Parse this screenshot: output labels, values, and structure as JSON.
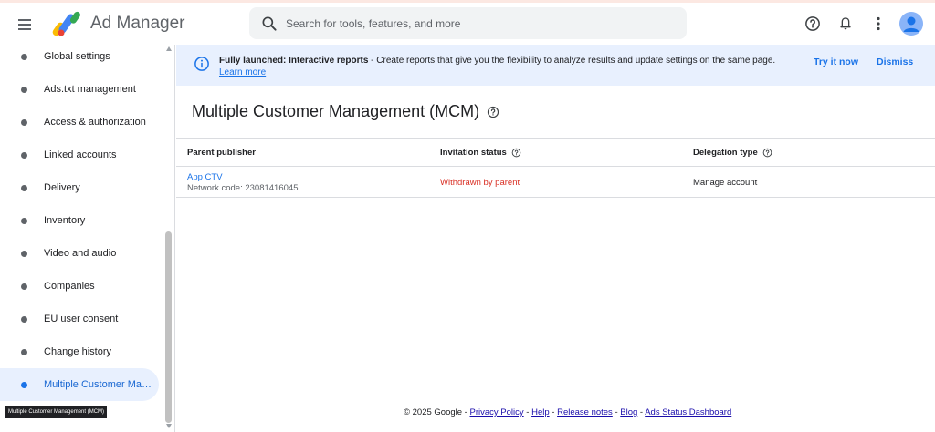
{
  "header": {
    "app_title": "Ad Manager",
    "search_placeholder": "Search for tools, features, and more"
  },
  "sidebar": {
    "items": [
      {
        "label": "Global settings"
      },
      {
        "label": "Ads.txt management"
      },
      {
        "label": "Access & authorization"
      },
      {
        "label": "Linked accounts"
      },
      {
        "label": "Delivery"
      },
      {
        "label": "Inventory"
      },
      {
        "label": "Video and audio"
      },
      {
        "label": "Companies"
      },
      {
        "label": "EU user consent"
      },
      {
        "label": "Change history"
      },
      {
        "label": "Multiple Customer Man..."
      }
    ],
    "active_index": 10,
    "tooltip": "Multiple Customer Management (MCM)"
  },
  "banner": {
    "bold": "Fully launched: Interactive reports",
    "text": " - Create reports that give you the flexibility to analyze results and update settings on the same page. ",
    "link": "Learn more",
    "try_label": "Try it now",
    "dismiss_label": "Dismiss"
  },
  "main": {
    "title": "Multiple Customer Management (MCM)",
    "table": {
      "columns": [
        "Parent publisher",
        "Invitation status",
        "Delegation type"
      ],
      "rows": [
        {
          "publisher": "App CTV",
          "network_code": "Network code: 23081416045",
          "status": "Withdrawn by parent",
          "delegation": "Manage account"
        }
      ]
    }
  },
  "footer": {
    "copyright": "© 2025 Google - ",
    "links": [
      "Privacy Policy",
      "Help",
      "Release notes",
      "Blog",
      "Ads Status Dashboard"
    ]
  },
  "colors": {
    "accent": "#1a73e8",
    "status_red": "#d93025",
    "banner_bg": "#e8f0fe"
  }
}
